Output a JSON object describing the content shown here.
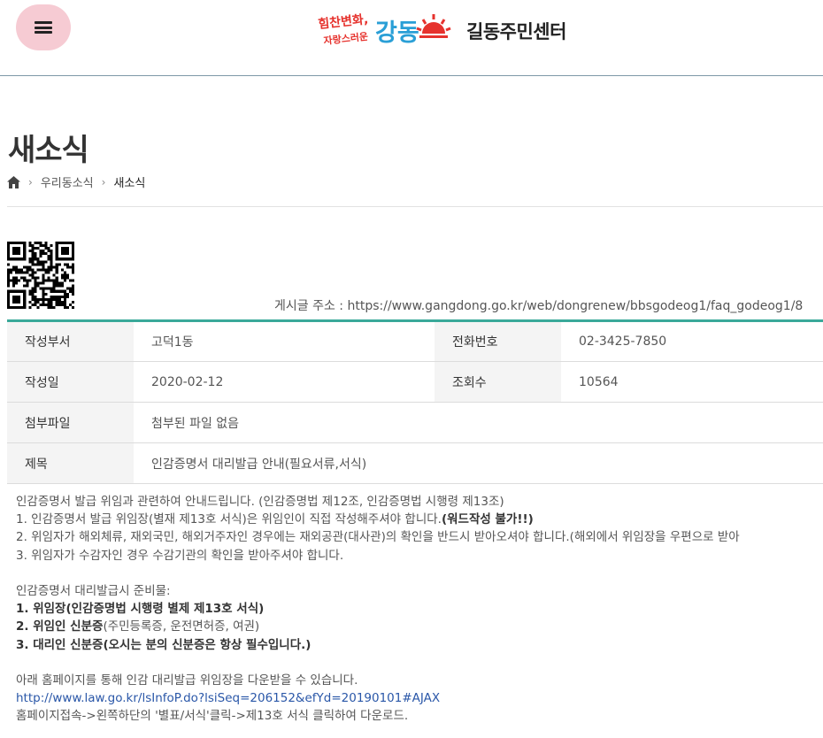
{
  "header": {
    "menu_label": "menu",
    "logo_slogan_top": "힘찬변화,",
    "logo_slogan_bottom": "자랑스러운",
    "logo_name": "강동",
    "site_name": "길동주민센터"
  },
  "page": {
    "title": "새소식",
    "breadcrumb": [
      "우리동소식",
      "새소식"
    ]
  },
  "post": {
    "url_label": "게시글 주소 :",
    "url": "https://www.gangdong.go.kr/web/dongrenew/bbsgodeog1/faq_godeog1/8",
    "fields": {
      "dept_label": "작성부서",
      "dept_value": "고덕1동",
      "phone_label": "전화번호",
      "phone_value": "02-3425-7850",
      "date_label": "작성일",
      "date_value": "2020-02-12",
      "views_label": "조회수",
      "views_value": "10564",
      "attach_label": "첨부파일",
      "attach_value": "첨부된 파일 없음",
      "subject_label": "제목",
      "subject_value": "인감증명서 대리발급 안내(필요서류,서식)"
    },
    "body": {
      "line1": "인감증명서 발급 위임과 관련하여 안내드립니다. (인감증명법 제12조, 인감증명법 시행령 제13조)",
      "line2_a": "1. 인감증명서 발급 위임장(별재 제13호 서식)은 위임인이 직접 작성해주셔야 합니다.",
      "line2_b": "(워드작성 불가!!)",
      "line3": "2. 위임자가 해외체류, 재외국민, 해외거주자인 경우에는 재외공관(대사관)의 확인을 반드시 받아오셔야 합니다.(해외에서 위임장을 우편으로 받아",
      "line4": "3. 위임자가 수감자인 경우 수감기관의 확인을 받아주셔야 합니다.",
      "line5": "인감증명서 대리발급시 준비물:",
      "line6": "1. 위임장(인감증명법 시행령 별제 제13호 서식)",
      "line7_a": "2. 위임인 신분증",
      "line7_b": "(주민등록증, 운전면허증, 여권)",
      "line8_a": "3. 대리인 신분증",
      "line8_b": "(오시는 분의 신분증은 항상 필수입니다.)",
      "line9": "아래 홈페이지를 통해 인감 대리발급 위임장을 다운받을 수 있습니다.",
      "link": "http://www.law.go.kr/lsInfoP.do?lsiSeq=206152&efYd=20190101#AJAX",
      "line10": "홈페이지접속->왼쪽하단의 '별표/서식'클릭->제13호 서식 클릭하여 다운로드."
    }
  },
  "colors": {
    "accent": "#3aa99a",
    "menu_button": "#f6cbd3",
    "logo_red": "#e6322d",
    "logo_blue": "#2a9fd6",
    "link": "#2a57a8"
  }
}
